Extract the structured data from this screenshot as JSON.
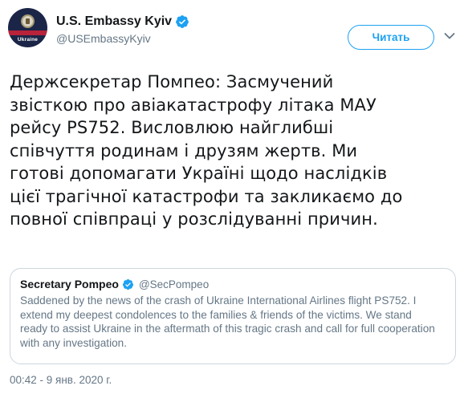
{
  "header": {
    "name": "U.S. Embassy Kyiv",
    "handle": "@USEmbassyKyiv",
    "avatar_label": "Ukraine",
    "follow_label": "Читать"
  },
  "tweet": {
    "lines": [
      "Держсекретар Помпео: Засмучений",
      "звісткою про авіакатастрофу літака МАУ",
      "рейсу PS752. Висловлюю найглибші",
      "співчуття родинам і друзям жертв. Ми",
      "готові допомагати Україні щодо наслідків",
      "цієї трагічної катастрофи та закликаємо до",
      "повної співпраці у розслідуванні причин."
    ]
  },
  "quote": {
    "name": "Secretary Pompeo",
    "handle": "@SecPompeo",
    "lines": [
      "Saddened by the news of the crash of Ukraine International Airlines flight PS752. I",
      "extend my deepest condolences to the families & friends of the victims. We stand",
      "ready to assist Ukraine in the aftermath of this tragic crash and call for full cooperation",
      "with any investigation."
    ]
  },
  "footer": {
    "timestamp": "00:42 - 9 янв. 2020 г."
  },
  "colors": {
    "accent": "#1da1f2",
    "secondary_text": "#657786",
    "border": "#ccd6dd"
  },
  "icons": [
    "verified-badge-icon",
    "chevron-down-icon"
  ]
}
